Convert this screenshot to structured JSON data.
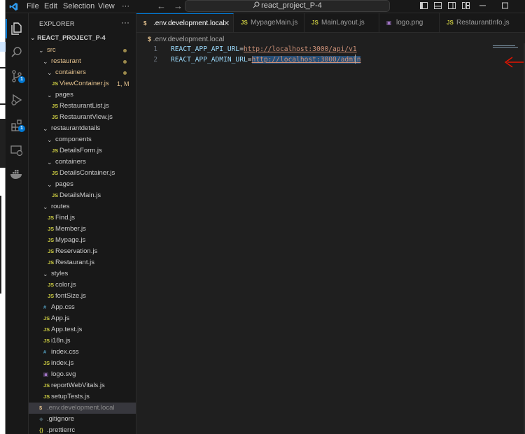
{
  "window": {
    "menu": [
      "File",
      "Edit",
      "Selection",
      "View",
      "···"
    ],
    "search_text": "react_project_P-4"
  },
  "activity": {
    "source_control_badge": "1",
    "extensions_badge": "1"
  },
  "explorer": {
    "title": "EXPLORER",
    "more": "···",
    "project": "REACT_PROJECT_P-4",
    "tree": [
      {
        "label": "src",
        "type": "folder",
        "depth": 1,
        "open": true,
        "color": "#e2c08d",
        "dot": true
      },
      {
        "label": "restaurant",
        "type": "folder",
        "depth": 2,
        "open": true,
        "color": "#e2c08d",
        "dot": true
      },
      {
        "label": "containers",
        "type": "folder",
        "depth": 3,
        "open": true,
        "color": "#e2c08d",
        "dot": true
      },
      {
        "label": "ViewContainer.js",
        "type": "js",
        "depth": 4,
        "color": "#e2c08d",
        "status": "1, M"
      },
      {
        "label": "pages",
        "type": "folder",
        "depth": 3,
        "open": true,
        "color": "#cccccc"
      },
      {
        "label": "RestaurantList.js",
        "type": "js",
        "depth": 4,
        "color": "#cccccc"
      },
      {
        "label": "RestaurantView.js",
        "type": "js",
        "depth": 4,
        "color": "#cccccc"
      },
      {
        "label": "restaurantdetails",
        "type": "folder",
        "depth": 2,
        "open": true,
        "color": "#cccccc"
      },
      {
        "label": "components",
        "type": "folder",
        "depth": 3,
        "open": true,
        "color": "#cccccc"
      },
      {
        "label": "DetailsForm.js",
        "type": "js",
        "depth": 4,
        "color": "#cccccc"
      },
      {
        "label": "containers",
        "type": "folder",
        "depth": 3,
        "open": true,
        "color": "#cccccc"
      },
      {
        "label": "DetailsContainer.js",
        "type": "js",
        "depth": 4,
        "color": "#cccccc"
      },
      {
        "label": "pages",
        "type": "folder",
        "depth": 3,
        "open": true,
        "color": "#cccccc"
      },
      {
        "label": "DetailsMain.js",
        "type": "js",
        "depth": 4,
        "color": "#cccccc"
      },
      {
        "label": "routes",
        "type": "folder",
        "depth": 2,
        "open": true,
        "color": "#cccccc"
      },
      {
        "label": "Find.js",
        "type": "js",
        "depth": 3,
        "color": "#cccccc"
      },
      {
        "label": "Member.js",
        "type": "js",
        "depth": 3,
        "color": "#cccccc"
      },
      {
        "label": "Mypage.js",
        "type": "js",
        "depth": 3,
        "color": "#cccccc"
      },
      {
        "label": "Reservation.js",
        "type": "js",
        "depth": 3,
        "color": "#cccccc"
      },
      {
        "label": "Restaurant.js",
        "type": "js",
        "depth": 3,
        "color": "#cccccc"
      },
      {
        "label": "styles",
        "type": "folder",
        "depth": 2,
        "open": true,
        "color": "#cccccc"
      },
      {
        "label": "color.js",
        "type": "js",
        "depth": 3,
        "color": "#cccccc"
      },
      {
        "label": "fontSize.js",
        "type": "js",
        "depth": 3,
        "color": "#cccccc"
      },
      {
        "label": "App.css",
        "type": "css",
        "depth": 2,
        "color": "#cccccc"
      },
      {
        "label": "App.js",
        "type": "js",
        "depth": 2,
        "color": "#cccccc"
      },
      {
        "label": "App.test.js",
        "type": "js",
        "depth": 2,
        "color": "#cccccc"
      },
      {
        "label": "i18n.js",
        "type": "js",
        "depth": 2,
        "color": "#cccccc"
      },
      {
        "label": "index.css",
        "type": "css",
        "depth": 2,
        "color": "#cccccc"
      },
      {
        "label": "index.js",
        "type": "js",
        "depth": 2,
        "color": "#cccccc"
      },
      {
        "label": "logo.svg",
        "type": "svg",
        "depth": 2,
        "color": "#cccccc"
      },
      {
        "label": "reportWebVitals.js",
        "type": "js",
        "depth": 2,
        "color": "#cccccc"
      },
      {
        "label": "setupTests.js",
        "type": "js",
        "depth": 2,
        "color": "#cccccc"
      },
      {
        "label": ".env.development.local",
        "type": "env",
        "depth": 1,
        "color": "#8b8b8b",
        "selected": true
      },
      {
        "label": ".gitignore",
        "type": "git",
        "depth": 1,
        "color": "#cccccc"
      },
      {
        "label": ".prettierrc",
        "type": "json",
        "depth": 1,
        "color": "#cccccc"
      }
    ]
  },
  "tabs": [
    {
      "label": ".env.development.local",
      "type": "env",
      "active": true
    },
    {
      "label": "MypageMain.js",
      "type": "js"
    },
    {
      "label": "MainLayout.js",
      "type": "js"
    },
    {
      "label": "logo.png",
      "type": "img"
    },
    {
      "label": "RestaurantInfo.js",
      "type": "js"
    }
  ],
  "breadcrumb": {
    "icon": "$",
    "file": ".env.development.local"
  },
  "editor": {
    "lines": [
      {
        "num": "1",
        "key": "REACT_APP_API_URL",
        "eq": "=",
        "url": "http://localhost:3000/api/v1"
      },
      {
        "num": "2",
        "key": "REACT_APP_ADMIN_URL",
        "eq": "=",
        "url": "http://localhost:3000/admin"
      }
    ]
  },
  "colors": {
    "accent": "#0078d4",
    "js_icon": "#cbcb41",
    "css_icon": "#519aba",
    "env_icon": "#e2c08d",
    "modified": "#e2c08d",
    "annotation_arrow": "#e51400"
  }
}
